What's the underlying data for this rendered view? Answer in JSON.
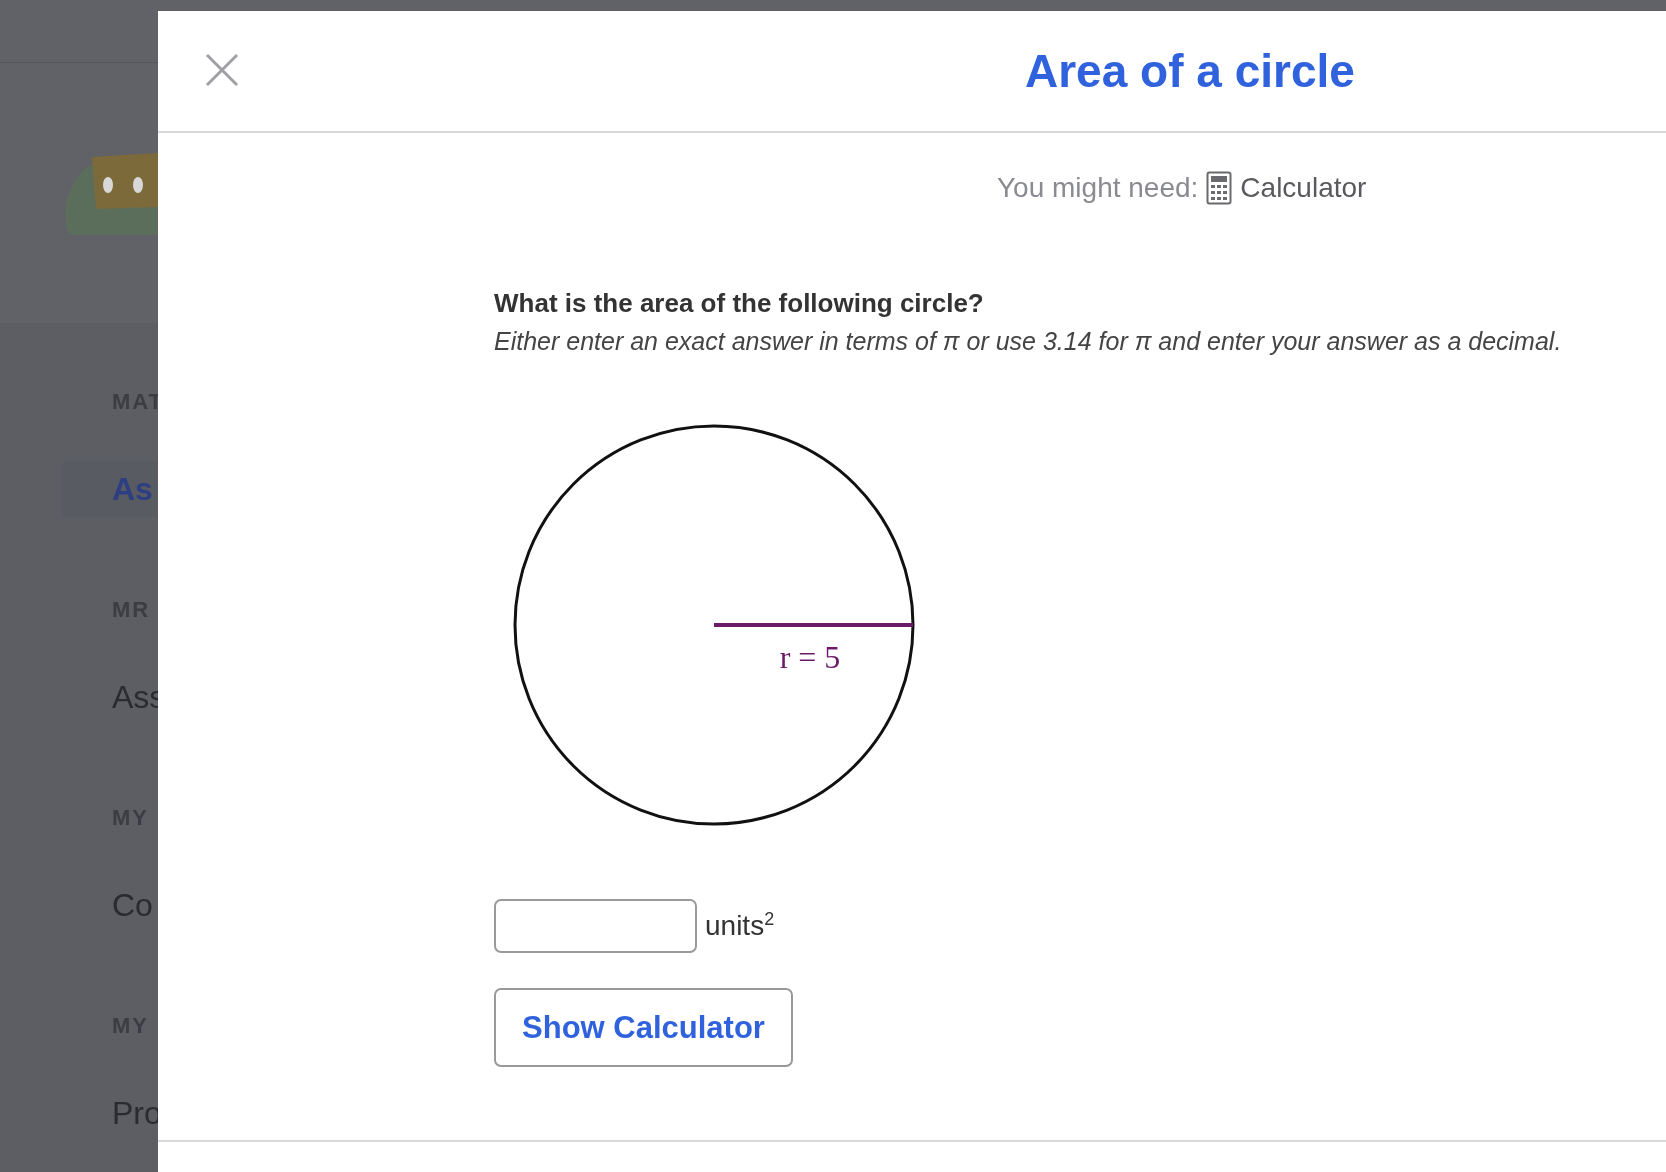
{
  "background": {
    "sidebar": [
      {
        "kind": "heading",
        "text": "MAT"
      },
      {
        "kind": "link",
        "text": "As",
        "selected": true
      },
      {
        "kind": "heading",
        "text": "MR"
      },
      {
        "kind": "link",
        "text": "Ass",
        "selected": false
      },
      {
        "kind": "heading",
        "text": "MY"
      },
      {
        "kind": "link",
        "text": "Co",
        "selected": false
      },
      {
        "kind": "heading",
        "text": "MY"
      },
      {
        "kind": "link",
        "text": "Pro",
        "selected": false
      }
    ]
  },
  "modal": {
    "title": "Area of a circle",
    "tools_label": "You might need:",
    "tool": "Calculator",
    "question": "What is the area of the following circle?",
    "instruction": "Either enter an exact answer in terms of π or use 3.14 for π and enter your answer as a decimal.",
    "figure_label": "r = 5",
    "unit": "units$^{2}$",
    "button": "Show Calculator"
  }
}
